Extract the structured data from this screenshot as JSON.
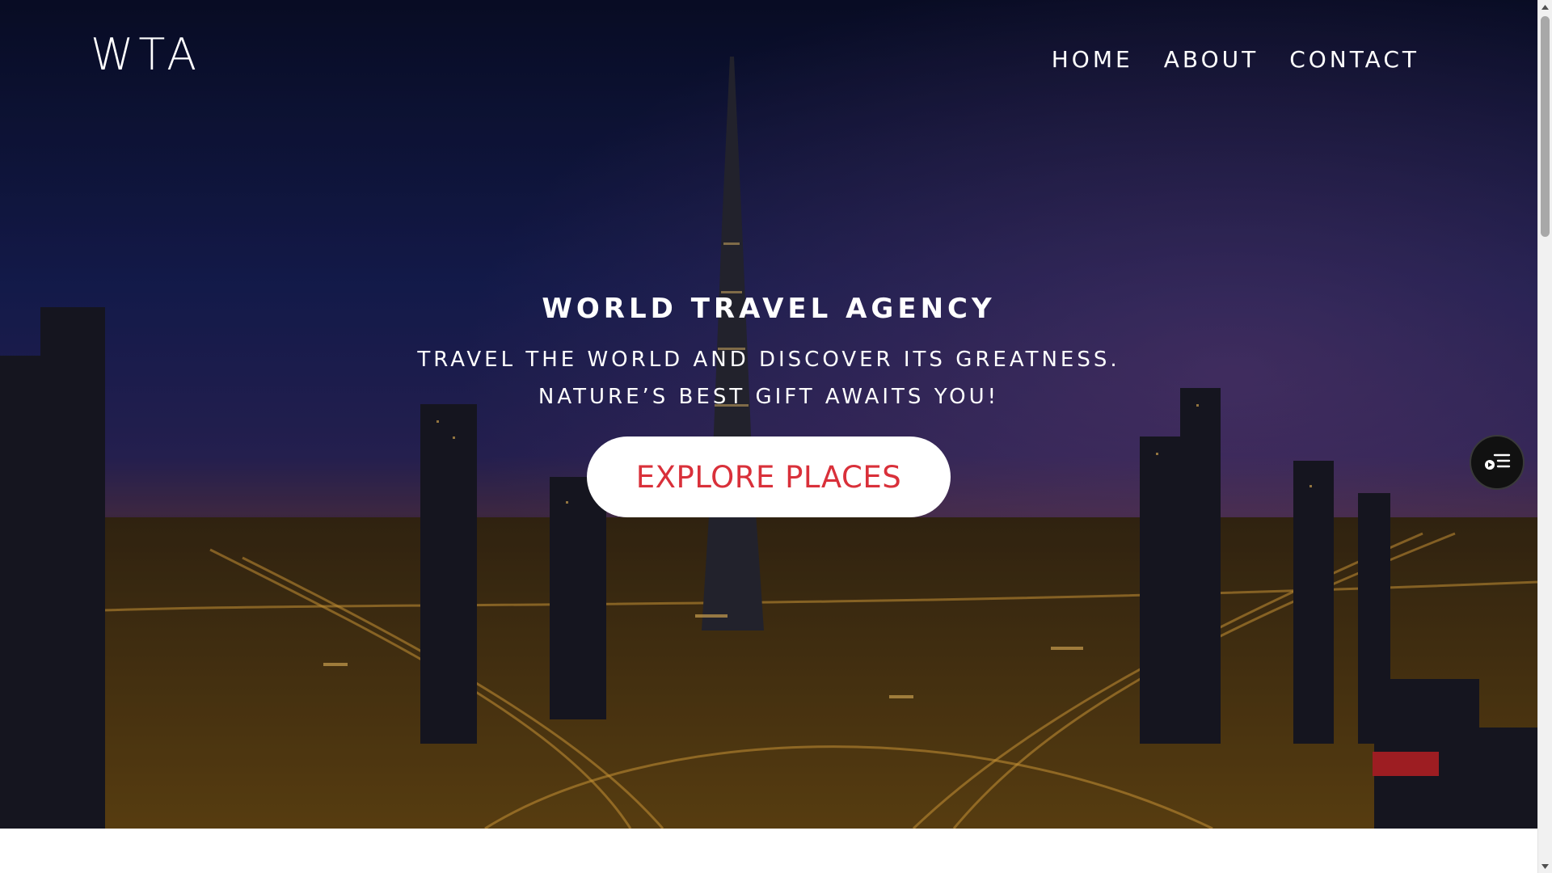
{
  "header": {
    "logo": "WTA",
    "nav": [
      {
        "label": "HOME"
      },
      {
        "label": "ABOUT"
      },
      {
        "label": "CONTACT"
      }
    ]
  },
  "hero": {
    "title": "WORLD TRAVEL AGENCY",
    "subtitle_line1": "TRAVEL THE WORLD AND DISCOVER ITS GREATNESS.",
    "subtitle_line2": "NATURE’S BEST GIFT AWAITS YOU!",
    "cta_label": "EXPLORE PLACES",
    "background": "night-city-skyline-photo"
  },
  "floating_widget": {
    "icon": "menu-list-icon"
  },
  "colors": {
    "cta_text": "#d9303a",
    "cta_bg": "#ffffff",
    "text": "#ffffff",
    "widget_bg": "#111111"
  }
}
